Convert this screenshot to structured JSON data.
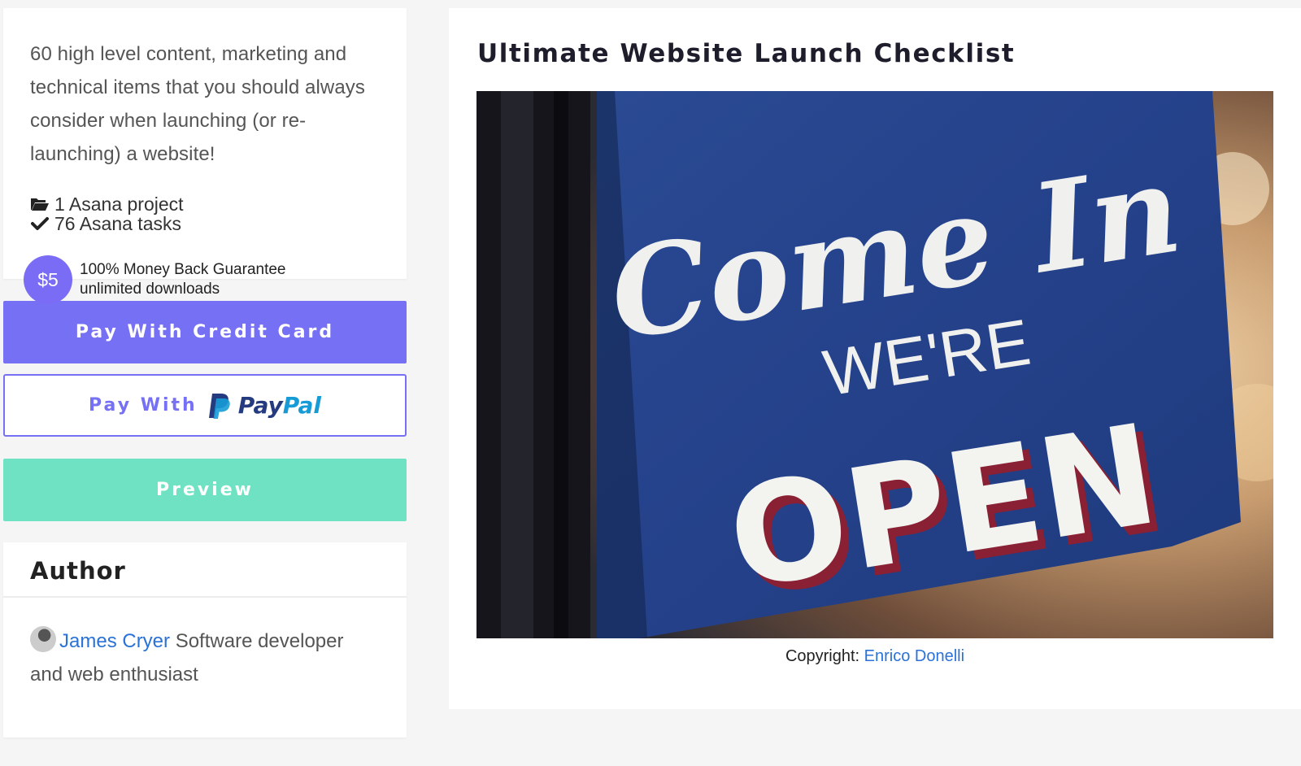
{
  "product": {
    "description": "60 high level content, marketing and technical items that you should always consider when launching (or re-launching) a website!",
    "stats": [
      {
        "icon": "folder-open-icon",
        "text": "1 Asana project"
      },
      {
        "icon": "checkmark-icon",
        "text": "76 Asana tasks"
      }
    ],
    "price": "$5",
    "guarantee_line1": "100% Money Back Guarantee",
    "guarantee_line2": "unlimited downloads",
    "title": "Ultimate Website Launch Checklist"
  },
  "buttons": {
    "credit_card": "Pay With Credit Card",
    "paypal_prefix": "Pay With",
    "paypal_brand_pay": "Pay",
    "paypal_brand_pal": "Pal",
    "preview": "Preview"
  },
  "author": {
    "heading": "Author",
    "name": "James Cryer",
    "bio": " Software developer and web enthusiast"
  },
  "image": {
    "sign_line1": "Come In",
    "sign_line2": "WE'RE",
    "sign_line3": "OPEN",
    "caption_label": "Copyright: ",
    "caption_link": "Enrico Donelli"
  },
  "colors": {
    "accent": "#7670f5",
    "preview": "#6ee2c2",
    "link": "#2a72d8",
    "sign_blue": "#27468e"
  }
}
